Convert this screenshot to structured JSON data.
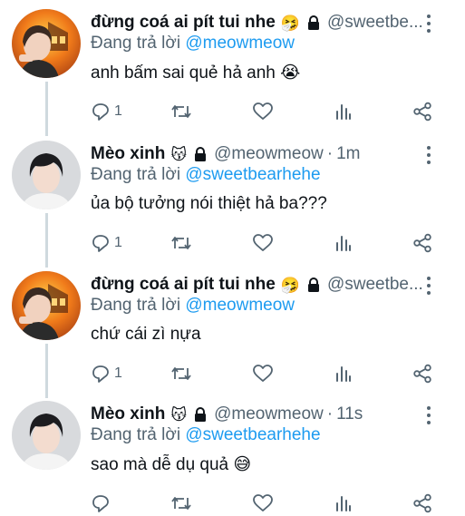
{
  "tweets": [
    {
      "display_name": "đừng coá ai pít tui nhe",
      "name_emoji": "🤧",
      "handle": "@sweetbe...",
      "separator": "",
      "time": "",
      "reply_prefix": "Đang trả lời",
      "reply_to": "@meowmeow",
      "text": "anh bấm sai quẻ hả anh 😭",
      "reply_count": "1",
      "avatar": "orange-fire-avatar"
    },
    {
      "display_name": "Mèo xinh",
      "name_emoji": "😽",
      "handle": "@meowmeow",
      "separator": "·",
      "time": "1m",
      "reply_prefix": "Đang trả lời",
      "reply_to": "@sweetbearhehe",
      "text": "ủa bộ tưởng nói thiệt hả ba???",
      "reply_count": "1",
      "avatar": "dark-hair-avatar"
    },
    {
      "display_name": "đừng coá ai pít tui nhe",
      "name_emoji": "🤧",
      "handle": "@sweetbe...",
      "separator": "",
      "time": "",
      "reply_prefix": "Đang trả lời",
      "reply_to": "@meowmeow",
      "text": "chứ cái zì nựa",
      "reply_count": "1",
      "avatar": "orange-fire-avatar"
    },
    {
      "display_name": "Mèo xinh",
      "name_emoji": "😽",
      "handle": "@meowmeow",
      "separator": "·",
      "time": "11s",
      "reply_prefix": "Đang trả lời",
      "reply_to": "@sweetbearhehe",
      "text": "sao mà dễ dụ quả 😅",
      "reply_count": "",
      "avatar": "dark-hair-avatar"
    }
  ],
  "icons": {
    "lock": "lock-icon",
    "more": "more-vertical-icon",
    "reply": "reply-icon",
    "retweet": "retweet-icon",
    "like": "heart-icon",
    "stats": "bar-chart-icon",
    "share": "share-icon"
  },
  "colors": {
    "text": "#0f1419",
    "secondary": "#536471",
    "mention": "#1d9bf0",
    "thread_line": "#cfd9de"
  }
}
